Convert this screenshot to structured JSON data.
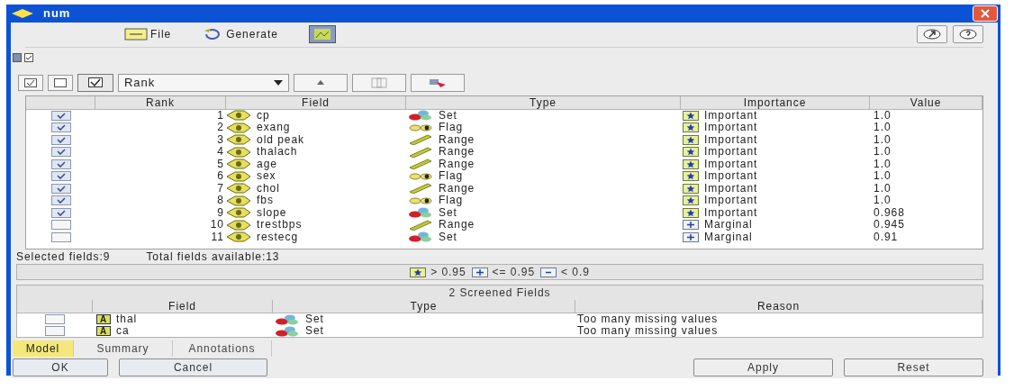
{
  "window": {
    "title": "num"
  },
  "menu": [
    {
      "label": "File",
      "kind": "file"
    },
    {
      "label": "Generate",
      "kind": "generate"
    }
  ],
  "view_checks": [
    {
      "checked": false
    },
    {
      "checked": true
    }
  ],
  "toolbar": {
    "sort_by": "Rank"
  },
  "table": {
    "columns": [
      "Rank",
      "Field",
      "Type",
      "Importance",
      "Value"
    ],
    "rows": [
      {
        "checked": true,
        "rank": "1",
        "field": "cp",
        "type": {
          "label": "Set",
          "kind": "set"
        },
        "importance": {
          "label": "Important",
          "kind": "important"
        },
        "value": "1.0"
      },
      {
        "checked": true,
        "rank": "2",
        "field": "exang",
        "type": {
          "label": "Flag",
          "kind": "flag"
        },
        "importance": {
          "label": "Important",
          "kind": "important"
        },
        "value": "1.0"
      },
      {
        "checked": true,
        "rank": "3",
        "field": "old peak",
        "type": {
          "label": "Range",
          "kind": "range"
        },
        "importance": {
          "label": "Important",
          "kind": "important"
        },
        "value": "1.0"
      },
      {
        "checked": true,
        "rank": "4",
        "field": "thalach",
        "type": {
          "label": "Range",
          "kind": "range"
        },
        "importance": {
          "label": "Important",
          "kind": "important"
        },
        "value": "1.0"
      },
      {
        "checked": true,
        "rank": "5",
        "field": "age",
        "type": {
          "label": "Range",
          "kind": "range"
        },
        "importance": {
          "label": "Important",
          "kind": "important"
        },
        "value": "1.0"
      },
      {
        "checked": true,
        "rank": "6",
        "field": "sex",
        "type": {
          "label": "Flag",
          "kind": "flag"
        },
        "importance": {
          "label": "Important",
          "kind": "important"
        },
        "value": "1.0"
      },
      {
        "checked": true,
        "rank": "7",
        "field": "chol",
        "type": {
          "label": "Range",
          "kind": "range"
        },
        "importance": {
          "label": "Important",
          "kind": "important"
        },
        "value": "1.0"
      },
      {
        "checked": true,
        "rank": "8",
        "field": "fbs",
        "type": {
          "label": "Flag",
          "kind": "flag"
        },
        "importance": {
          "label": "Important",
          "kind": "important"
        },
        "value": "1.0"
      },
      {
        "checked": true,
        "rank": "9",
        "field": "slope",
        "type": {
          "label": "Set",
          "kind": "set"
        },
        "importance": {
          "label": "Important",
          "kind": "important"
        },
        "value": "0.968"
      },
      {
        "checked": false,
        "rank": "10",
        "field": "trestbps",
        "type": {
          "label": "Range",
          "kind": "range"
        },
        "importance": {
          "label": "Marginal",
          "kind": "marginal"
        },
        "value": "0.945"
      },
      {
        "checked": false,
        "rank": "11",
        "field": "restecg",
        "type": {
          "label": "Set",
          "kind": "set"
        },
        "importance": {
          "label": "Marginal",
          "kind": "marginal"
        },
        "value": "0.91"
      }
    ]
  },
  "status": {
    "selected": "Selected fields:9",
    "total": "Total fields available:13"
  },
  "legend": [
    {
      "kind": "important",
      "text": "> 0.95"
    },
    {
      "kind": "marginal",
      "text": "<= 0.95"
    },
    {
      "kind": "unimportant",
      "text": "< 0.9"
    }
  ],
  "screened": {
    "title": "2 Screened Fields",
    "columns": [
      "Field",
      "Type",
      "Reason"
    ],
    "rows": [
      {
        "checked": false,
        "badge": "A",
        "field": "thal",
        "type": {
          "label": "Set",
          "kind": "set"
        },
        "reason": "Too many missing values"
      },
      {
        "checked": false,
        "badge": "A",
        "field": "ca",
        "type": {
          "label": "Set",
          "kind": "set"
        },
        "reason": "Too many missing values"
      }
    ]
  },
  "tabs": [
    {
      "label": "Model",
      "selected": true
    },
    {
      "label": "Summary",
      "selected": false
    },
    {
      "label": "Annotations",
      "selected": false
    }
  ],
  "buttons": {
    "left": [
      "OK",
      "Cancel"
    ],
    "right": [
      "Apply",
      "Reset"
    ]
  }
}
